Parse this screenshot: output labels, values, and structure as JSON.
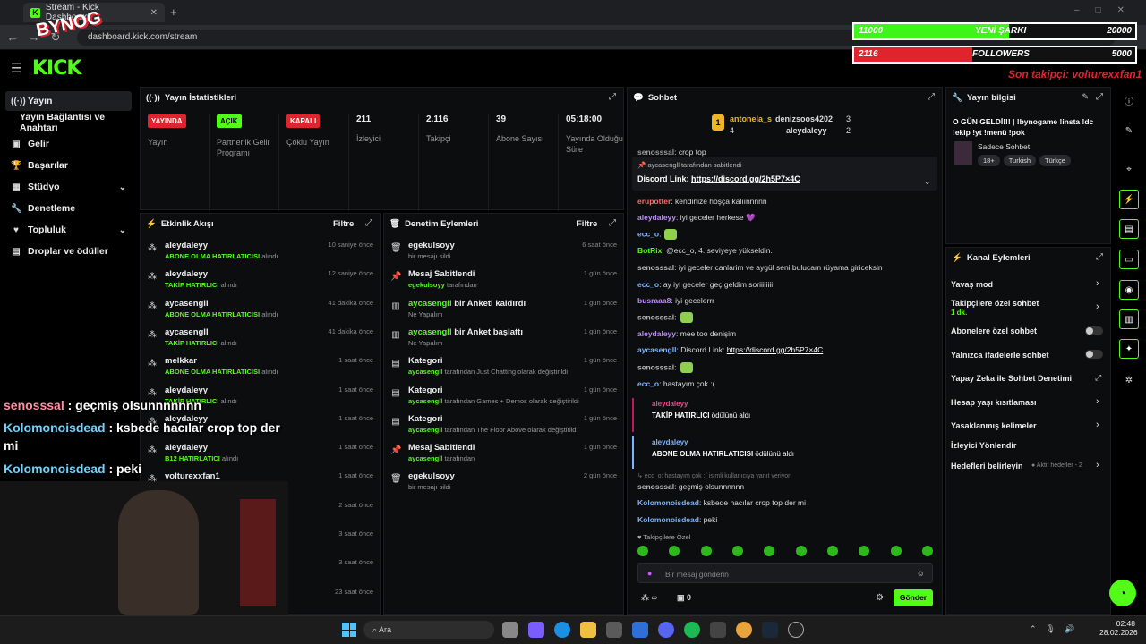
{
  "browser": {
    "tab_title": "Stream - Kick Dashboard",
    "url": "dashboard.kick.com/stream"
  },
  "app": {
    "logo": "KICK"
  },
  "leftnav": {
    "items": [
      {
        "label": "Yayın",
        "icon": "broadcast-icon"
      },
      {
        "label": "Yayın Bağlantısı ve Anahtarı",
        "icon": ""
      },
      {
        "label": "Gelir",
        "icon": "money-icon"
      },
      {
        "label": "Başarılar",
        "icon": "trophy-icon"
      },
      {
        "label": "Stüdyo",
        "icon": "studio-icon"
      },
      {
        "label": "Denetleme",
        "icon": "wrench-icon"
      },
      {
        "label": "Topluluk",
        "icon": "community-icon"
      },
      {
        "label": "Droplar ve ödüller",
        "icon": "gift-icon"
      }
    ]
  },
  "stats": {
    "title": "Yayın İstatistikleri",
    "cells": [
      {
        "badge": "YAYINDA",
        "label": "Yayın"
      },
      {
        "badge": "AÇIK",
        "label": "Partnerlik Gelir Programı"
      },
      {
        "badge": "KAPALI",
        "label": "Çoklu Yayın"
      },
      {
        "value": "211",
        "label": "İzleyici"
      },
      {
        "value": "2.116",
        "label": "Takipçi"
      },
      {
        "value": "39",
        "label": "Abone Sayısı"
      },
      {
        "value": "05:18:00",
        "label": "Yayında Olduğu Süre"
      }
    ]
  },
  "events": {
    "title": "Etkinlik Akışı",
    "filter": "Filtre",
    "rows": [
      {
        "name": "aleydaleyy",
        "sub_b": "ABONE OLMA HATIRLATICISI",
        "sub": " alındı",
        "time": "10 saniye önce"
      },
      {
        "name": "aleydaleyy",
        "sub_b": "TAKİP HATIRLICI",
        "sub": " alındı",
        "time": "12 saniye önce"
      },
      {
        "name": "aycasengll",
        "sub_b": "ABONE OLMA HATIRLATICISI",
        "sub": " alındı",
        "time": "41 dakika önce"
      },
      {
        "name": "aycasengll",
        "sub_b": "TAKİP HATIRLICI",
        "sub": " alındı",
        "time": "41 dakika önce"
      },
      {
        "name": "melkkar",
        "sub_b": "ABONE OLMA HATIRLATICISI",
        "sub": " alındı",
        "time": "1 saat önce"
      },
      {
        "name": "aleydaleyy",
        "sub_b": "TAKİP HATIRLICI",
        "sub": " alındı",
        "time": "1 saat önce"
      },
      {
        "name": "aleydaleyy",
        "sub_b": "",
        "sub": "alındı",
        "time": "1 saat önce"
      },
      {
        "name": "aleydaleyy",
        "sub_b": "B12 HATIRLATICI",
        "sub": " alındı",
        "time": "1 saat önce"
      },
      {
        "name": "volturexxfan1",
        "sub_b": "",
        "sub": "",
        "time": "1 saat önce"
      }
    ],
    "extra_times": [
      "2 saat önce",
      "3 saat önce",
      "3 saat önce",
      "23 saat önce"
    ]
  },
  "mod": {
    "title": "Denetim Eylemleri",
    "filter": "Filtre",
    "rows": [
      {
        "icon": "trash-icon",
        "name": "egekulsoyy",
        "sub": "bir mesajı sildi",
        "time": "6 saat önce"
      },
      {
        "icon": "pin-icon",
        "name": "Mesaj Sabitlendi",
        "sub_b": "egekulsoyy",
        "sub": " tarafından",
        "time": "1 gün önce"
      },
      {
        "icon": "poll-icon",
        "name_b": "aycasengll",
        "name": " bir Anketi kaldırdı",
        "sub": "Ne Yapalım",
        "time": "1 gün önce"
      },
      {
        "icon": "poll-icon",
        "name_b": "aycasengll",
        "name": " bir Anket başlattı",
        "sub": "Ne Yapalım",
        "time": "1 gün önce"
      },
      {
        "icon": "category-icon",
        "name": "Kategori",
        "sub_b": "aycasengll",
        "sub": " tarafından Just Chatting olarak değiştirildi",
        "time": "1 gün önce"
      },
      {
        "icon": "category-icon",
        "name": "Kategori",
        "sub_b": "aycasengll",
        "sub": " tarafından Games + Demos olarak değiştirildi",
        "time": "1 gün önce"
      },
      {
        "icon": "category-icon",
        "name": "Kategori",
        "sub_b": "aycasengll",
        "sub": " tarafından The Floor Above olarak değiştirildi",
        "time": "1 gün önce"
      },
      {
        "icon": "pin-icon",
        "name": "Mesaj Sabitlendi",
        "sub_b": "aycasengll",
        "sub": " tarafından",
        "time": "1 gün önce"
      },
      {
        "icon": "trash-icon",
        "name": "egekulsoyy",
        "sub": "bir mesajı sildi",
        "time": "2 gün önce"
      }
    ]
  },
  "chat": {
    "title": "Sohbet",
    "top_gifters": [
      {
        "name": "antonela_s",
        "count": "4"
      },
      {
        "name": "denizsoos4202",
        "count": "3"
      },
      {
        "name": "aleydaleyy",
        "count": "2"
      }
    ],
    "pinned": {
      "by": "aycasengll tarafından sabitlendi",
      "text": "Discord Link:",
      "link": "https://discord.gg/2h5P7×4C"
    },
    "messages": [
      {
        "user": "senosssal",
        "color": "#9a9a9a",
        "text": ": crop top"
      },
      {
        "user": "erupotter",
        "color": "#ff6b6b",
        "text": ": kendinize hoşça kalıınnnnn"
      },
      {
        "user": "aleydaleyy",
        "color": "#c08cff",
        "text": ": iyi geceler herkese 💜"
      },
      {
        "user": "ecc_o",
        "color": "#7fb2ff",
        "text": ":"
      },
      {
        "user": "BotRix",
        "color": "#53fc18",
        "text": ": @ecc_o, 4. seviyeye yükseldin."
      },
      {
        "user": "senosssal",
        "color": "#bbbbbb",
        "text": ": iyi geceler canlarim ve aygül seni bulucam rüyama giriceksin"
      },
      {
        "user": "ecc_o",
        "color": "#7fb2ff",
        "text": ": ay iyi geceler geç geldim soriiiiiiii"
      },
      {
        "user": "busraaa8",
        "color": "#c08cff",
        "text": ": iyi gecelerrr"
      },
      {
        "user": "senosssal",
        "color": "#bbbbbb",
        "text": ":"
      },
      {
        "user": "aleydaleyy",
        "color": "#c08cff",
        "text": ": mee too denişim"
      },
      {
        "user": "aycasengll",
        "color": "#7fb2ff",
        "text": ": Discord Link: "
      },
      {
        "user": "senosssal",
        "color": "#bbbbbb",
        "text": ":"
      },
      {
        "user": "ecc_o",
        "color": "#7fb2ff",
        "text": ": hastayım çok :("
      }
    ],
    "discord_link": "https://discord.gg/2h5P7×4C",
    "event1": {
      "user": "aleydaleyy",
      "title": "TAKİP HATIRLICI",
      "rest": " ödülünü aldı"
    },
    "event2": {
      "user": "aleydaleyy",
      "title": "ABONE OLMA HATIRLATICISI",
      "rest": " ödülünü aldı"
    },
    "reply_hint": "↳ ecc_o: hastayım çok :( isimli kullanıcıya yanıt veriyor",
    "tail": [
      {
        "user": "senosssal",
        "color": "#bbbbbb",
        "text": ": geçmiş olsunnnnnn"
      },
      {
        "user": "Kolomonoisdead",
        "color": "#7fb2ff",
        "text": ": ksbede hacılar crop top der mi"
      },
      {
        "user": "Kolomonoisdead",
        "color": "#7fb2ff",
        "text": ": peki"
      }
    ],
    "followers_only": "Takipçilere Özel",
    "input_placeholder": "Bir mesaj gönderin",
    "points": "∞",
    "count": "0",
    "send": "Gönder"
  },
  "info": {
    "title": "Yayın bilgisi",
    "stream_title": "O GÜN GELDİ!!! | !bynogame !insta !dc !ekip !yt !menü !pok",
    "category": "Sadece Sohbet",
    "tags": [
      "18+",
      "Turkish",
      "Türkçe"
    ]
  },
  "channel": {
    "title": "Kanal Eylemleri",
    "items": [
      {
        "label": "Yavaş mod",
        "type": "arrow"
      },
      {
        "label": "Takipçilere özel sohbet",
        "sub": "1 dk.",
        "type": "arrow"
      },
      {
        "label": "Abonelere özel sohbet",
        "type": "toggle"
      },
      {
        "label": "Yalnızca ifadelerle sohbet",
        "type": "toggle"
      },
      {
        "label": "Yapay Zeka ile Sohbet Denetimi",
        "type": "ext"
      },
      {
        "label": "Hesap yaşı kısıtlaması",
        "type": "arrow"
      },
      {
        "label": "Yasaklanmış kelimeler",
        "type": "arrow"
      },
      {
        "label": "İzleyici Yönlendir",
        "type": "none"
      },
      {
        "label": "Hedefleri belirleyin",
        "type": "arrow",
        "note": "● Aktif hedefler - 2"
      }
    ]
  },
  "overlay": {
    "bar1_left": "11000",
    "bar1_mid": "YENİ ŞARKI",
    "bar1_right": "20000",
    "bar1_fill": 0.55,
    "bar2_left": "2116",
    "bar2_mid": "FOLLOWERS",
    "bar2_right": "5000",
    "bar2_fill": 0.42,
    "last_follower": "Son takipçi: volturexxfan1",
    "brand": "BYNOG",
    "chat": [
      {
        "user": "senosssal",
        "text": " : geçmiş olsunnnnnnn"
      },
      {
        "user": "Kolomonoisdead",
        "text": " : ksbede hacılar crop top der"
      },
      {
        "user": "",
        "text": "mi"
      },
      {
        "user": "Kolomonoisdead",
        "text": " : peki"
      }
    ]
  },
  "taskbar": {
    "search": "Ara",
    "time": "02:48",
    "date": "28.02.2026"
  },
  "colors": {
    "accent": "#53fc18",
    "live": "#e0242e",
    "panel": "#0c0d0f"
  }
}
